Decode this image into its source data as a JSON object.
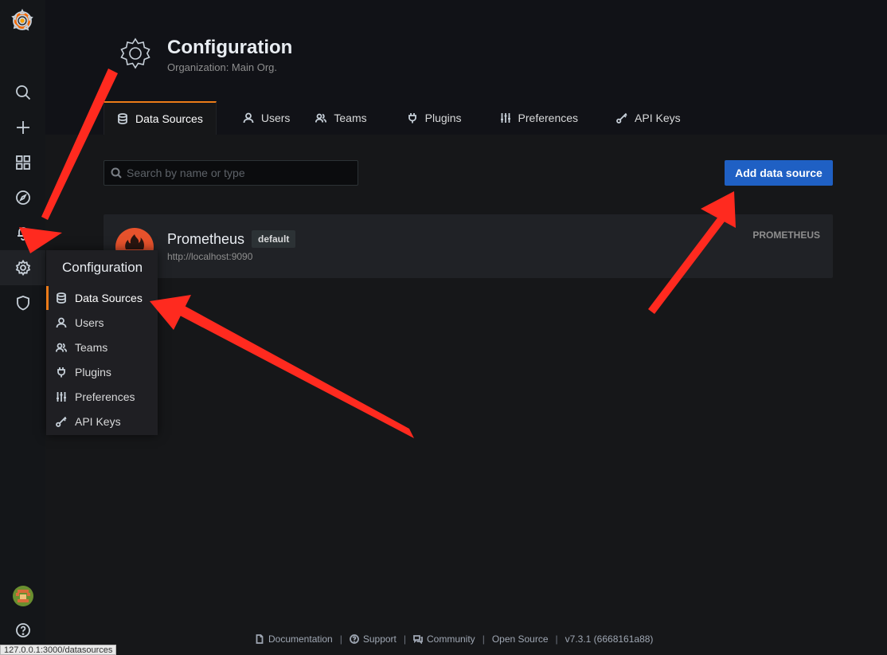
{
  "page": {
    "title": "Configuration",
    "subtitle": "Organization: Main Org."
  },
  "tabs": [
    {
      "label": "Data Sources",
      "icon": "database-icon",
      "active": true
    },
    {
      "label": "Users",
      "icon": "user-icon"
    },
    {
      "label": "Teams",
      "icon": "users-icon"
    },
    {
      "label": "Plugins",
      "icon": "plug-icon"
    },
    {
      "label": "Preferences",
      "icon": "sliders-icon"
    },
    {
      "label": "API Keys",
      "icon": "key-icon"
    }
  ],
  "toolbar": {
    "search_placeholder": "Search by name or type",
    "add_button_label": "Add data source"
  },
  "datasources": [
    {
      "name": "Prometheus",
      "badge": "default",
      "url": "http://localhost:9090",
      "type": "PROMETHEUS",
      "logo_color": "#e6522c"
    }
  ],
  "sidebar": {
    "icons": [
      "grafana-logo-icon",
      "search-icon",
      "plus-icon",
      "dashboards-icon",
      "explore-icon",
      "bell-icon",
      "gear-icon",
      "shield-icon",
      "avatar",
      "help-icon"
    ],
    "active": "gear-icon"
  },
  "flyout": {
    "title": "Configuration",
    "items": [
      {
        "label": "Data Sources",
        "active": true
      },
      {
        "label": "Users"
      },
      {
        "label": "Teams"
      },
      {
        "label": "Plugins"
      },
      {
        "label": "Preferences"
      },
      {
        "label": "API Keys"
      }
    ]
  },
  "footer": {
    "documentation": "Documentation",
    "support": "Support",
    "community": "Community",
    "open_source": "Open Source",
    "version": "v7.3.1 (6668161a88)",
    "separator": "|"
  },
  "status_bar": {
    "url": "127.0.0.1:3000/datasources"
  },
  "colors": {
    "accent": "#eb7b18",
    "primary_button": "#1f60c4",
    "annotation_arrow": "#ff2a1f"
  }
}
